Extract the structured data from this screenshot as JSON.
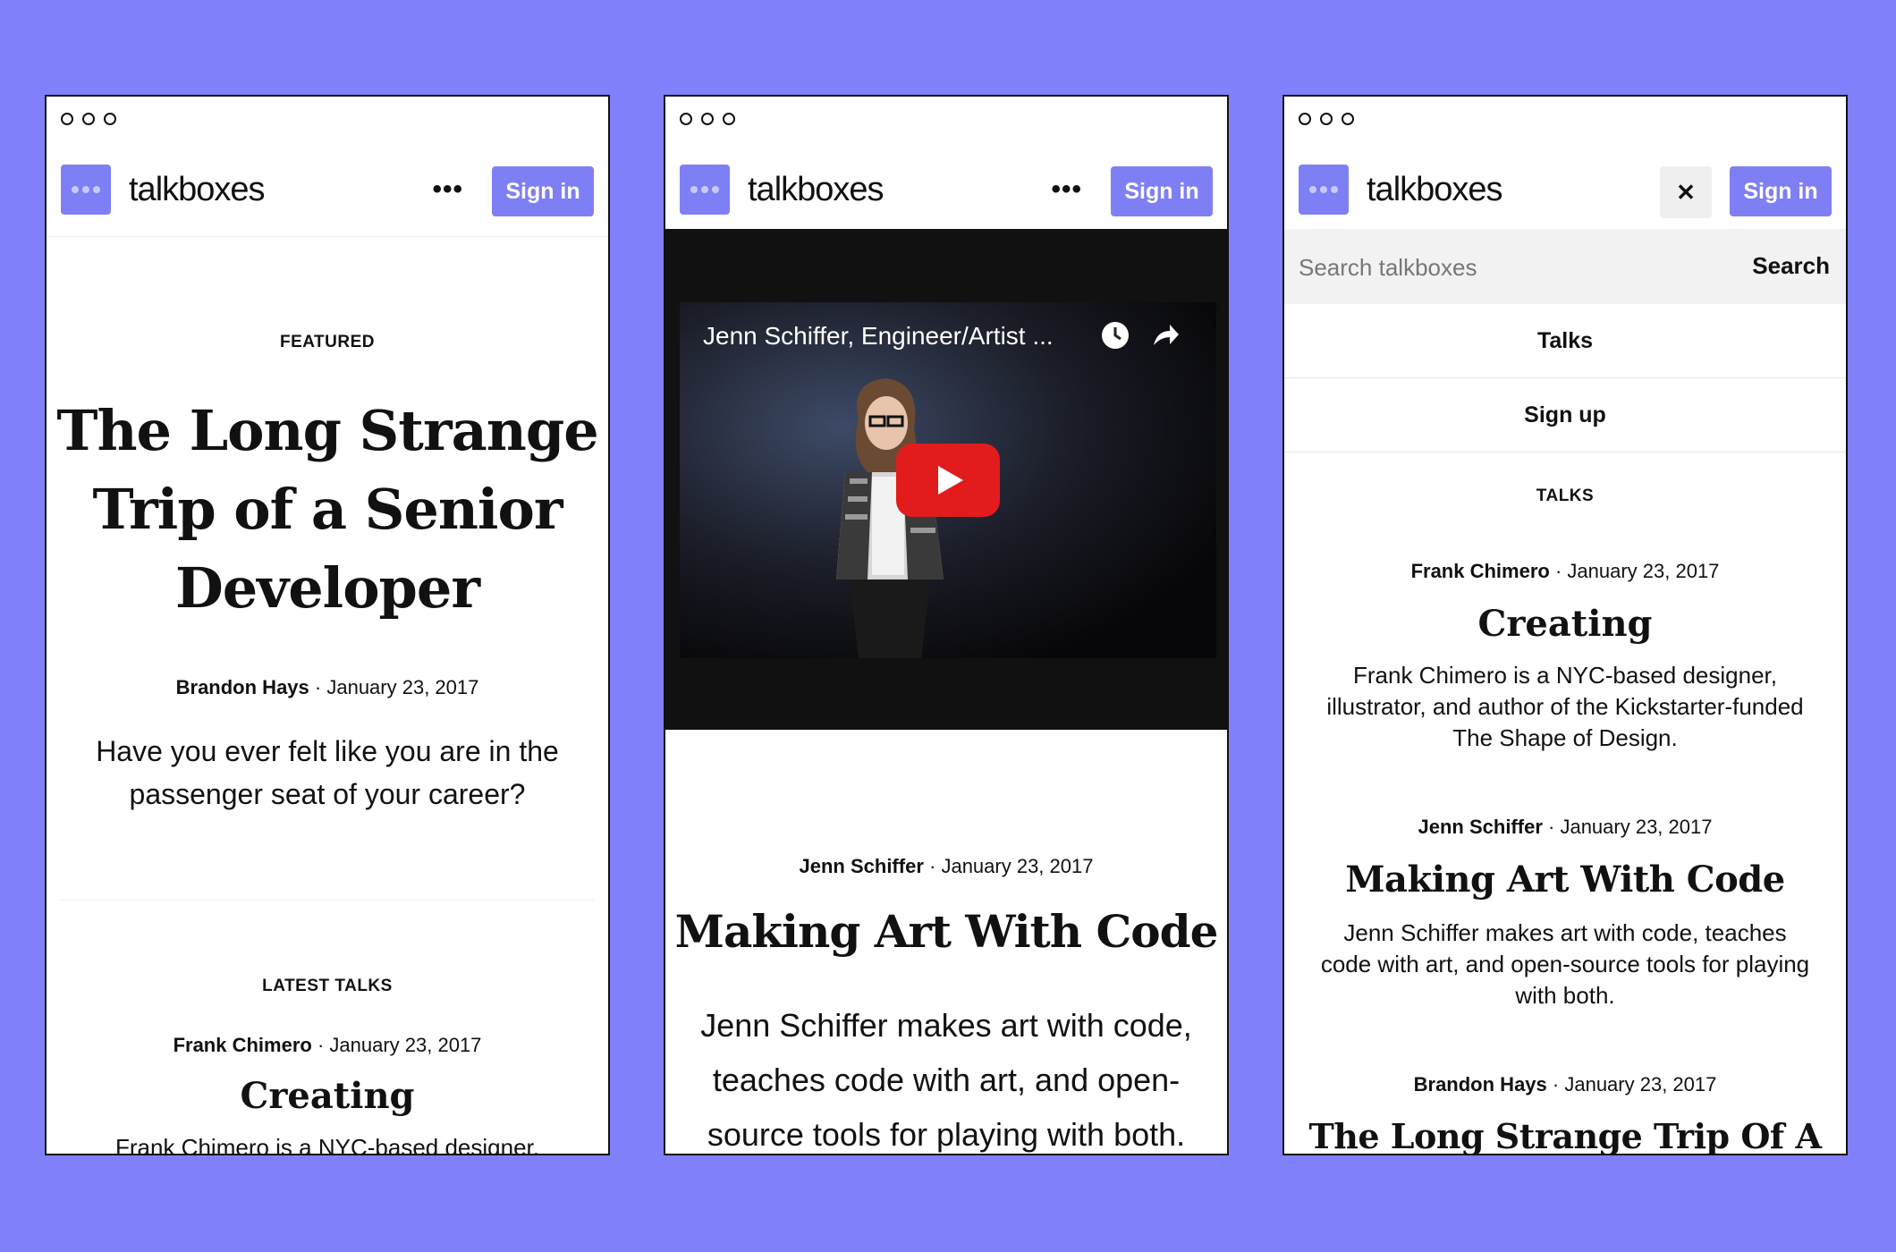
{
  "header": {
    "brand": "talkboxes",
    "signin_label": "Sign in",
    "more_label": "•••",
    "close_label": "✕"
  },
  "screen1": {
    "kicker": "FEATURED",
    "title_lines": [
      "The Long Strange",
      "Trip of a Senior",
      "Developer"
    ],
    "author": "Brandon Hays",
    "date": "· January 23, 2017",
    "summary_lines": [
      "Have you ever felt like you are in the",
      "passenger seat of your career?"
    ],
    "latest_heading": "LATEST TALKS",
    "latest_author": "Frank Chimero",
    "latest_date": "· January 23, 2017",
    "latest_title": "Creating",
    "latest_desc_partial": "Frank Chimero is a NYC-based designer,"
  },
  "screen2": {
    "video_title": "Jenn Schiffer, Engineer/Artist ...",
    "author": "Jenn Schiffer",
    "date": "· January 23, 2017",
    "title": "Making Art With Code",
    "desc_lines": [
      "Jenn Schiffer makes art with code,",
      "teaches code with art, and open-",
      "source tools for playing with both."
    ]
  },
  "screen3": {
    "search_placeholder": "Search talkboxes",
    "search_button": "Search",
    "menu": [
      "Talks",
      "Sign up"
    ],
    "section_heading": "TALKS",
    "talks": [
      {
        "author": "Frank Chimero",
        "date": "· January 23, 2017",
        "title": "Creating",
        "desc_lines": [
          "Frank Chimero is a NYC-based designer,",
          "illustrator, and author of the Kickstarter-funded",
          "The Shape of Design."
        ]
      },
      {
        "author": "Jenn Schiffer",
        "date": "· January 23, 2017",
        "title": "Making Art With Code",
        "desc_lines": [
          "Jenn Schiffer makes art with code, teaches",
          "code with art, and open-source tools for playing",
          "with both."
        ]
      },
      {
        "author": "Brandon Hays",
        "date": "· January 23, 2017",
        "title": "The Long Strange Trip Of A"
      }
    ]
  },
  "colors": {
    "accent": "#7f7ff5",
    "background": "#8080fb",
    "video_bg": "#111111",
    "play_button": "#e21c1c"
  }
}
